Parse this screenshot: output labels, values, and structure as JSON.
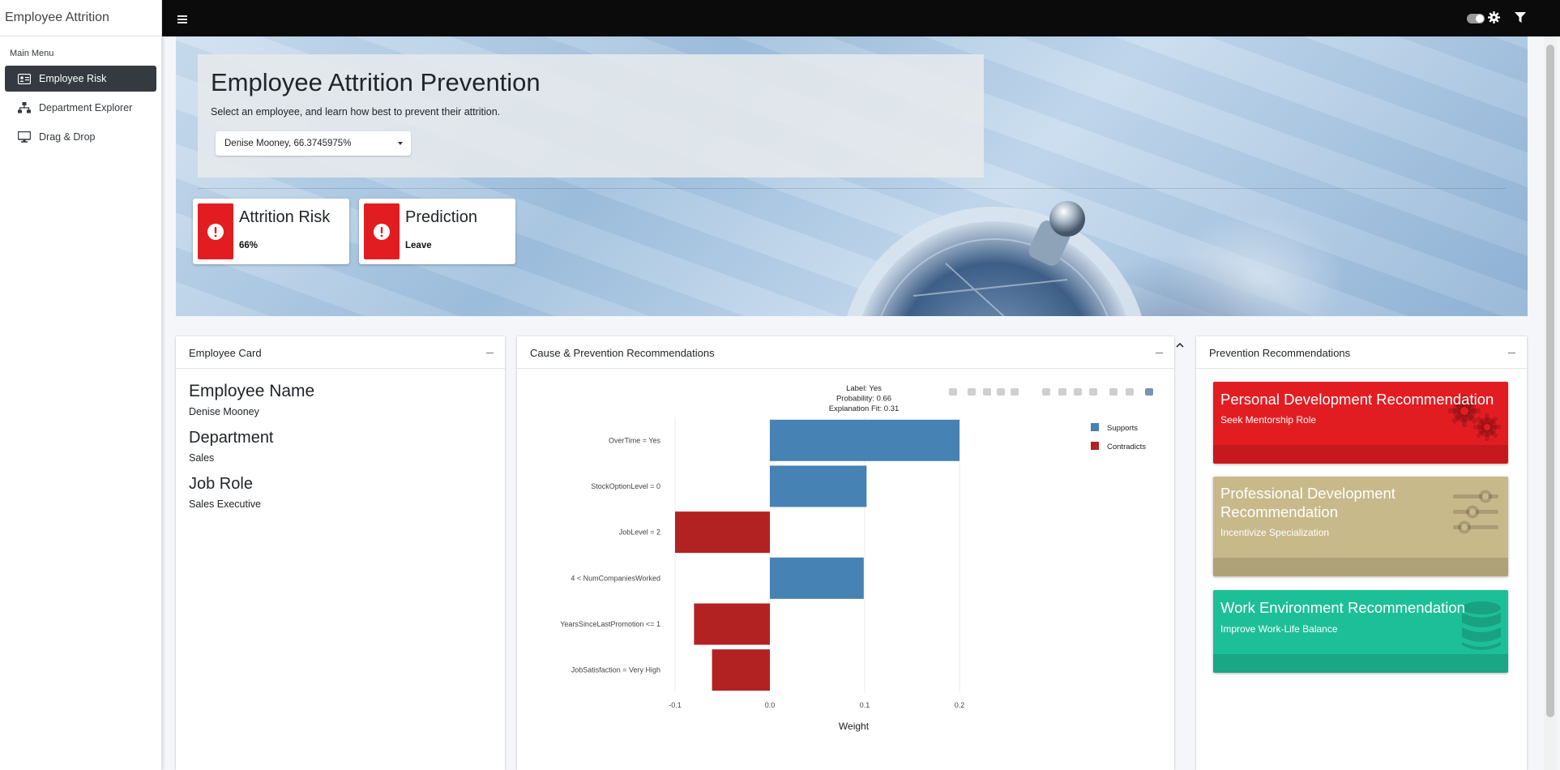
{
  "brand": "Employee Attrition",
  "sidebar": {
    "header": "Main Menu",
    "items": [
      {
        "label": "Employee Risk",
        "icon": "id-card-icon",
        "active": true
      },
      {
        "label": "Department Explorer",
        "icon": "sitemap-icon",
        "active": false
      },
      {
        "label": "Drag & Drop",
        "icon": "desktop-icon",
        "active": false
      }
    ]
  },
  "topbar": {
    "icons": [
      "hamburger-icon",
      "toggle-icon",
      "gear-icon",
      "filter-icon"
    ]
  },
  "hero": {
    "title": "Employee Attrition Prevention",
    "subtitle": "Select an employee, and learn how best to prevent their attrition.",
    "select_value": "Denise Mooney, 66.3745975%"
  },
  "infoboxes": [
    {
      "title": "Attrition Risk",
      "value": "66%",
      "icon": "exclamation-circle-icon",
      "color": "#e21d22"
    },
    {
      "title": "Prediction",
      "value": "Leave",
      "icon": "exclamation-circle-icon",
      "color": "#e21d22"
    }
  ],
  "employee_card": {
    "title": "Employee Card",
    "fields": [
      {
        "label": "Employee Name",
        "value": "Denise Mooney"
      },
      {
        "label": "Department",
        "value": "Sales"
      },
      {
        "label": "Job Role",
        "value": "Sales Executive"
      }
    ]
  },
  "chart_card": {
    "title": "Cause & Prevention Recommendations"
  },
  "chart_data": {
    "type": "bar",
    "orientation": "horizontal",
    "annotation": [
      "Label: Yes",
      "Probability: 0.66",
      "Explanation Fit: 0.31"
    ],
    "categories": [
      "OverTime = Yes",
      "StockOptionLevel = 0",
      "JobLevel = 2",
      "4 < NumCompaniesWorked",
      "YearsSinceLastPromotion <= 1",
      "JobSatisfaction = Very High"
    ],
    "values": [
      0.2,
      0.102,
      -0.1,
      0.099,
      -0.08,
      -0.061
    ],
    "xlabel": "Weight",
    "xlim": [
      -0.1,
      0.2
    ],
    "xticks": [
      "-0.1",
      "0.0",
      "0.1",
      "0.2"
    ],
    "legend": [
      {
        "name": "Supports",
        "color": "#4682b4"
      },
      {
        "name": "Contradicts",
        "color": "#b22222"
      }
    ],
    "legend_position": "top-right",
    "grid": true
  },
  "recommendations_card": {
    "title": "Prevention Recommendations",
    "items": [
      {
        "title": "Personal Development Recommendation",
        "text": "Seek Mentorship Role",
        "color": "#e21d22",
        "icon": "cogs-icon"
      },
      {
        "title": "Professional Development Recommendation",
        "text": "Incentivize Specialization",
        "color": "#c8b98a",
        "icon": "sliders-icon"
      },
      {
        "title": "Work Environment Recommendation",
        "text": "Improve Work-Life Balance",
        "color": "#1dbf98",
        "icon": "database-icon"
      }
    ]
  }
}
